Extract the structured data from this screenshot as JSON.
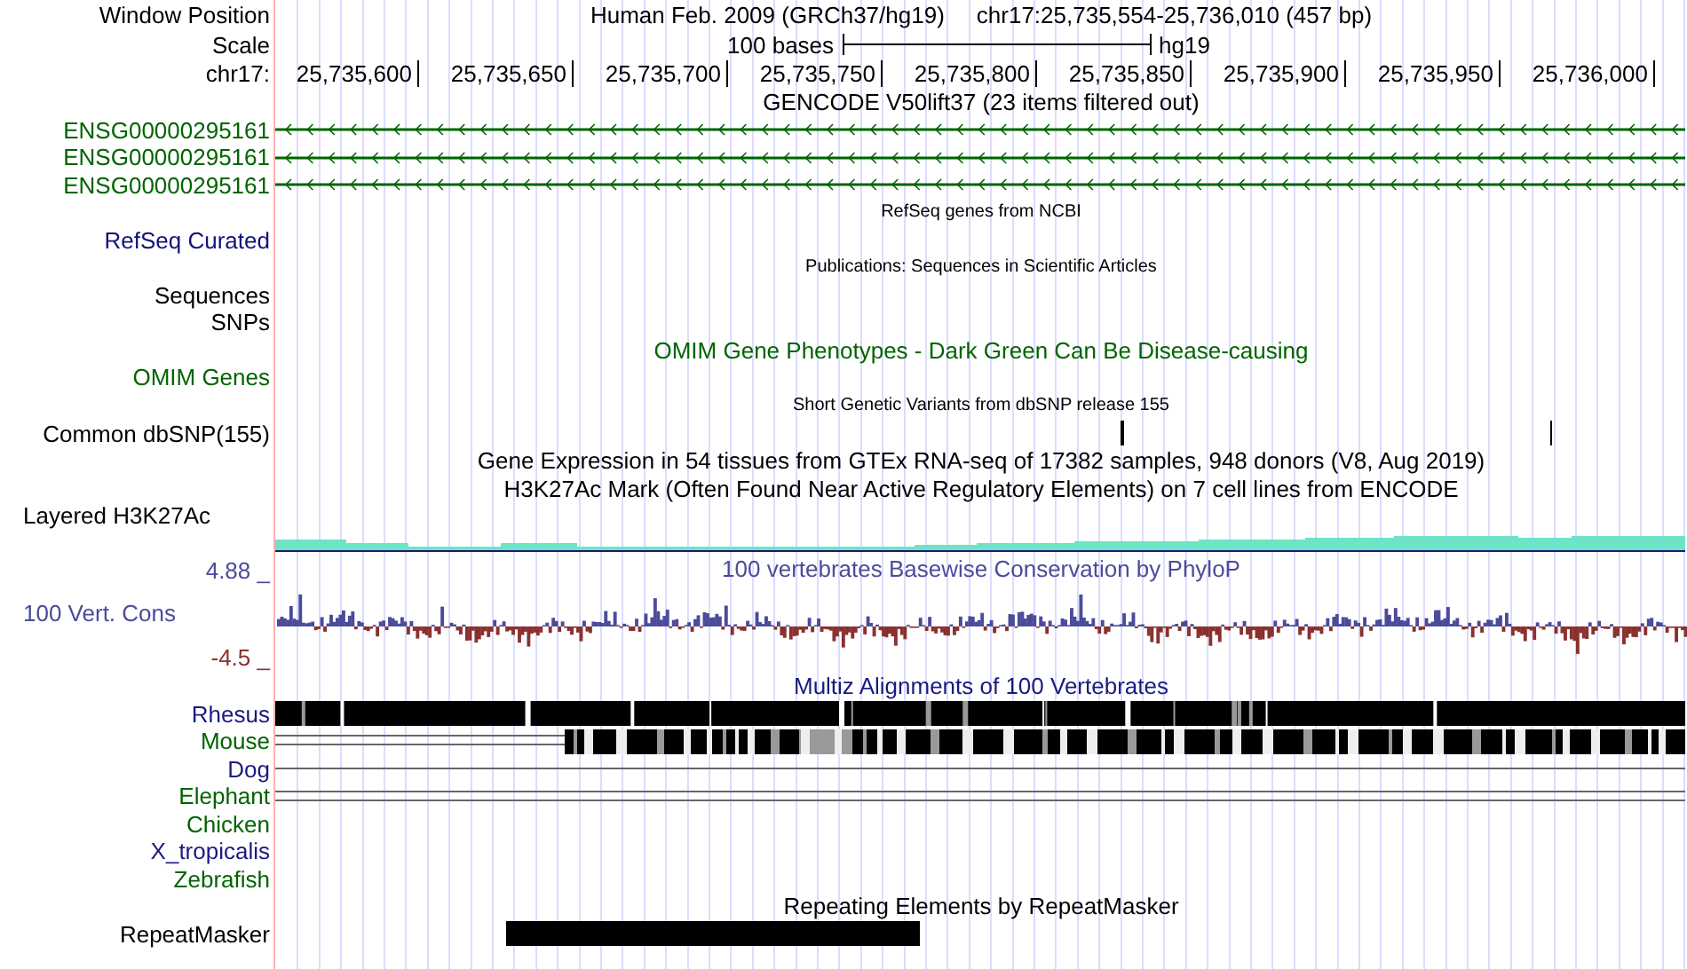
{
  "header": {
    "position_label": "Window Position",
    "assembly_title": "Human Feb. 2009 (GRCh37/hg19)",
    "position": "chr17:25,735,554-25,736,010 (457 bp)",
    "scale_label": "Scale",
    "scale_text": "100 bases",
    "scale_assembly": "hg19",
    "chrom_label": "chr17:",
    "ruler_ticks": [
      "25,735,600",
      "25,735,650",
      "25,735,700",
      "25,735,750",
      "25,735,800",
      "25,735,850",
      "25,735,900",
      "25,735,950",
      "25,736,000"
    ]
  },
  "tracks": [
    {
      "kind": "caption",
      "text": "GENCODE V50lift37 (23 items filtered out)",
      "small": false,
      "color": "#000000"
    },
    {
      "kind": "gene",
      "label": "ENSG00000295161",
      "color": "#006400",
      "reverse": true
    },
    {
      "kind": "gene",
      "label": "ENSG00000295161",
      "color": "#006400",
      "reverse": true
    },
    {
      "kind": "gene",
      "label": "ENSG00000295161",
      "color": "#006400",
      "reverse": true
    },
    {
      "kind": "caption",
      "text": "RefSeq genes from NCBI",
      "small": true,
      "color": "#000000"
    },
    {
      "kind": "label",
      "label": "RefSeq Curated",
      "color": "#12127a"
    },
    {
      "kind": "caption",
      "text": "Publications: Sequences in Scientific Articles",
      "small": true,
      "color": "#000000"
    },
    {
      "kind": "label",
      "label": "Sequences",
      "color": "#000000"
    },
    {
      "kind": "label",
      "label": "SNPs",
      "color": "#000000"
    },
    {
      "kind": "caption",
      "text": "OMIM Gene Phenotypes - Dark Green Can Be Disease-causing",
      "small": false,
      "color": "#006400"
    },
    {
      "kind": "label",
      "label": "OMIM Genes",
      "color": "#006400"
    },
    {
      "kind": "caption",
      "text": "Short Genetic Variants from dbSNP release 155",
      "small": true,
      "color": "#000000"
    },
    {
      "kind": "snp",
      "label": "Common dbSNP(155)",
      "color": "#000000"
    },
    {
      "kind": "caption",
      "text": "Gene Expression in 54 tissues from GTEx RNA-seq of 17382 samples, 948 donors (V8, Aug 2019)",
      "small": false,
      "color": "#000000"
    },
    {
      "kind": "caption",
      "text": "H3K27Ac Mark (Often Found Near Active Regulatory Elements) on 7 cell lines from ENCODE",
      "small": false,
      "color": "#000000"
    },
    {
      "kind": "layered",
      "label": "Layered H3K27Ac",
      "color": "#000000"
    },
    {
      "kind": "wiggle",
      "title": "100 vertebrates Basewise Conservation by PhyloP",
      "label": "100 Vert. Cons",
      "max_label": "4.88 _",
      "min_label": "-4.5 _",
      "color": "#4b4b9b"
    },
    {
      "kind": "caption",
      "text": "Multiz Alignments of 100 Vertebrates",
      "small": false,
      "color": "#1a1a80"
    },
    {
      "kind": "aligned",
      "label": "Rhesus",
      "color": "#1a1a80"
    },
    {
      "kind": "partial",
      "label": "Mouse",
      "color": "#006400"
    },
    {
      "kind": "chain",
      "label": "Dog",
      "color": "#1a1a80"
    },
    {
      "kind": "doublechain",
      "label": "Elephant",
      "color": "#006400"
    },
    {
      "kind": "label",
      "label": "Chicken",
      "color": "#006400"
    },
    {
      "kind": "label",
      "label": "X_tropicalis",
      "color": "#1a1a80"
    },
    {
      "kind": "label",
      "label": "Zebrafish",
      "color": "#006400"
    },
    {
      "kind": "caption",
      "text": "Repeating Elements by RepeatMasker",
      "small": false,
      "color": "#000000"
    },
    {
      "kind": "repeat",
      "label": "RepeatMasker",
      "color": "#000000"
    }
  ]
}
